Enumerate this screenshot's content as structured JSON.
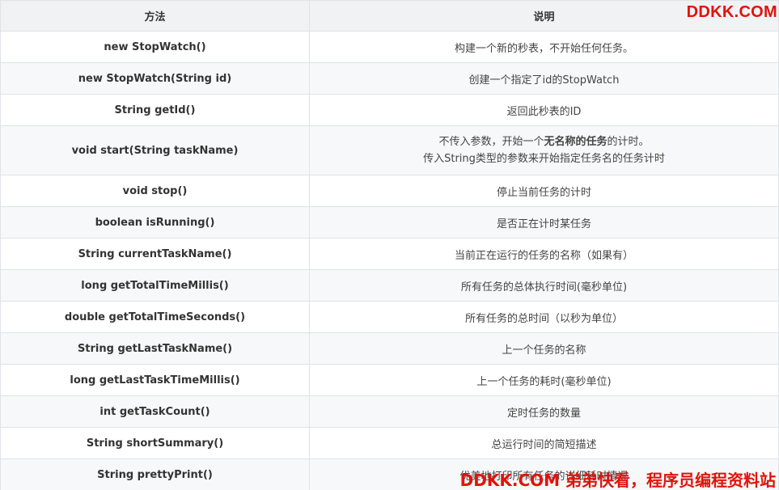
{
  "header": {
    "col_method": "方法",
    "col_desc": "说明"
  },
  "rows": [
    {
      "method": "new StopWatch()",
      "desc": "构建一个新的秒表，不开始任何任务。"
    },
    {
      "method": "new StopWatch(String id)",
      "desc": "创建一个指定了id的StopWatch"
    },
    {
      "method": "String getId()",
      "desc": "返回此秒表的ID"
    },
    {
      "method": "void start(String taskName)",
      "desc_line1_pre": "不传入参数，开始一个",
      "desc_line1_bold": "无名称的任务",
      "desc_line1_post": "的计时。",
      "desc_line2": "传入String类型的参数来开始指定任务名的任务计时"
    },
    {
      "method": "void stop()",
      "desc": "停止当前任务的计时"
    },
    {
      "method": "boolean isRunning()",
      "desc": "是否正在计时某任务"
    },
    {
      "method": "String currentTaskName()",
      "desc": "当前正在运行的任务的名称（如果有）"
    },
    {
      "method": "long getTotalTimeMillis()",
      "desc": "所有任务的总体执行时间(毫秒单位)"
    },
    {
      "method": "double getTotalTimeSeconds()",
      "desc": "所有任务的总时间（以秒为单位）"
    },
    {
      "method": "String getLastTaskName()",
      "desc": "上一个任务的名称"
    },
    {
      "method": "long getLastTaskTimeMillis()",
      "desc": "上一个任务的耗时(毫秒单位)"
    },
    {
      "method": "int getTaskCount()",
      "desc": "定时任务的数量"
    },
    {
      "method": "String shortSummary()",
      "desc": "总运行时间的简短描述"
    },
    {
      "method": "String prettyPrint()",
      "desc": "优美地打印所有任务的详细耗时情况"
    }
  ],
  "watermark": {
    "top": "DDKK.COM",
    "bottom": "DDKK.COM 弟弟快看，程序员编程资料站",
    "color": "#e0140b"
  }
}
